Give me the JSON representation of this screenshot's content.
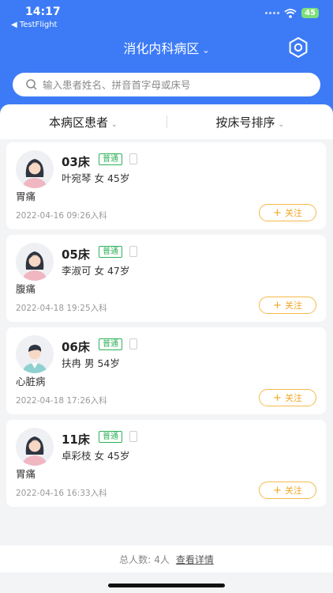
{
  "status_bar": {
    "time": "14:17",
    "back_app": "◀ TestFlight",
    "battery": "45"
  },
  "header": {
    "ward_title": "消化内科病区",
    "ward_chevron": "⌄",
    "settings_icon": "gear-icon"
  },
  "search": {
    "placeholder": "输入患者姓名、拼音首字母或床号"
  },
  "filters": [
    {
      "label": "本病区患者",
      "chevron": "⌄"
    },
    {
      "label": "按床号排序",
      "chevron": "⌄"
    }
  ],
  "patients": [
    {
      "bed": "03床",
      "level": "普通",
      "info": "叶宛琴 女 45岁",
      "diagnosis": "胃痛",
      "admit_time": "2022-04-16 09:26入科",
      "follow": "关注",
      "avatar": "female-avatar-icon"
    },
    {
      "bed": "05床",
      "level": "普通",
      "info": "李淑可 女 47岁",
      "diagnosis": "腹痛",
      "admit_time": "2022-04-18 19:25入科",
      "follow": "关注",
      "avatar": "female-avatar-icon"
    },
    {
      "bed": "06床",
      "level": "普通",
      "info": "扶冉 男 54岁",
      "diagnosis": "心脏病",
      "admit_time": "2022-04-18 17:26入科",
      "follow": "关注",
      "avatar": "male-avatar-icon"
    },
    {
      "bed": "11床",
      "level": "普通",
      "info": "卓彩枝 女 45岁",
      "diagnosis": "胃痛",
      "admit_time": "2022-04-16 16:33入科",
      "follow": "关注",
      "avatar": "female-avatar-icon"
    }
  ],
  "footer": {
    "total_label": "总人数:",
    "total_count": "4人",
    "detail_link": "查看详情"
  },
  "colors": {
    "primary": "#3d7bf6",
    "level_green": "#2fb15a",
    "follow_orange": "#f0a623"
  }
}
